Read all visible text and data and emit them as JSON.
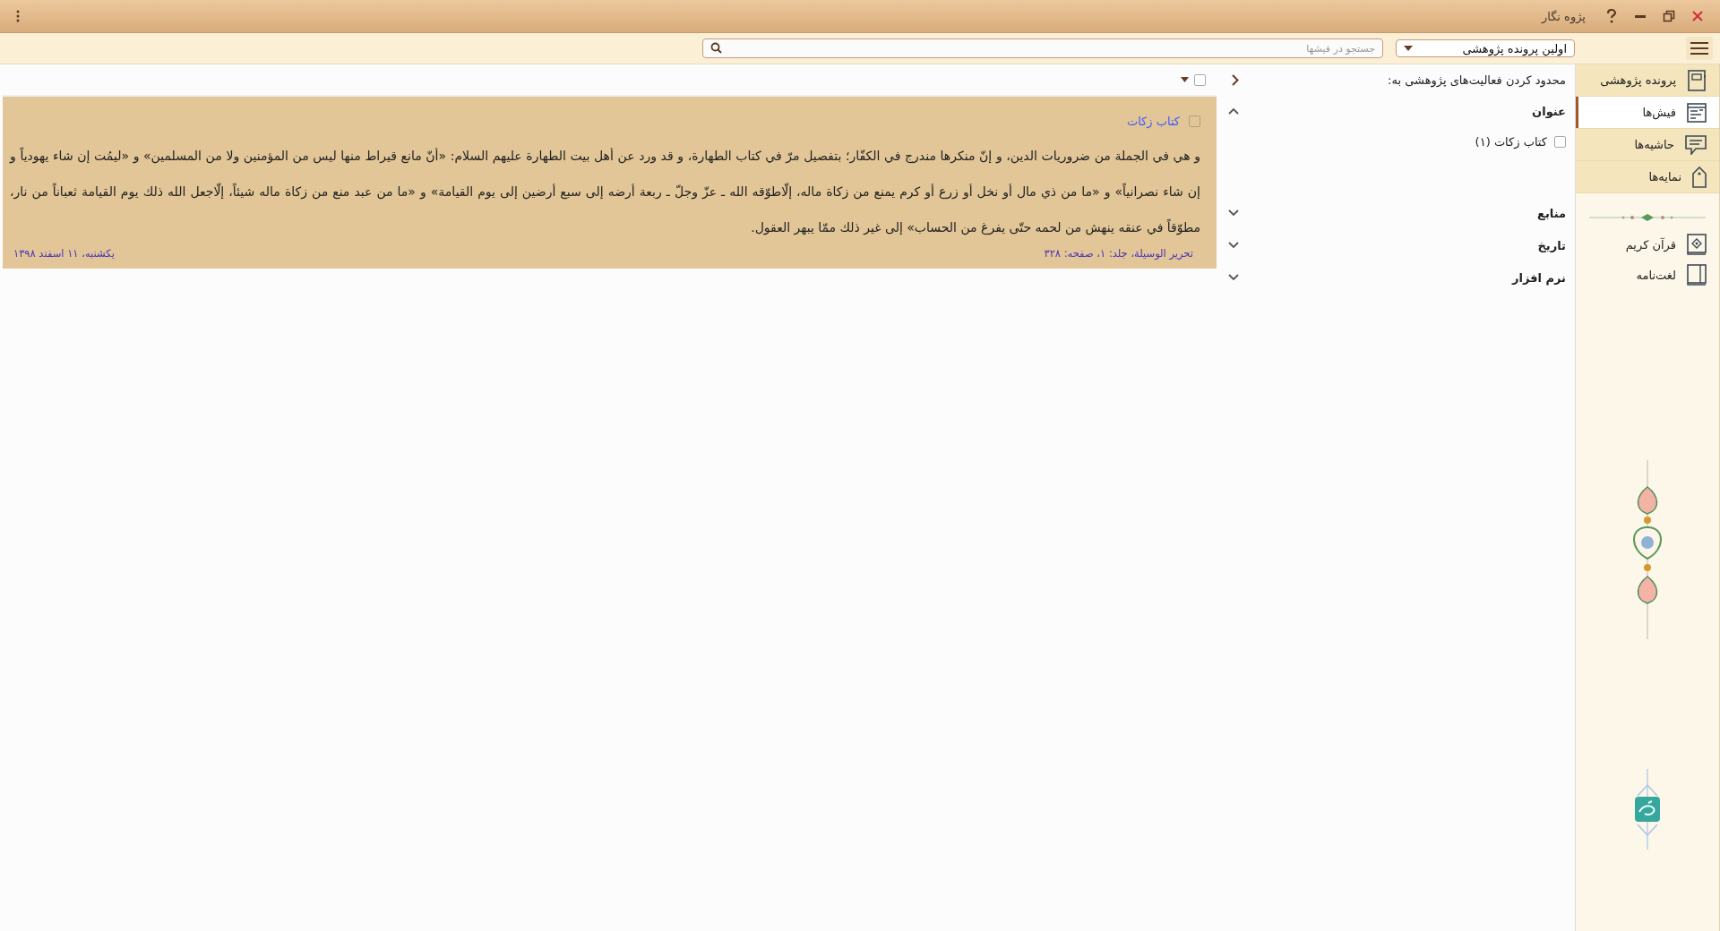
{
  "window": {
    "title": "پژوه نگار"
  },
  "toolbar": {
    "project": "اولین پرونده پژوهشی",
    "search": {
      "placeholder": "جستجو در فیشها"
    }
  },
  "nav": {
    "items": [
      {
        "label": "پرونده پژوهشی",
        "selected": false,
        "kind": "section"
      },
      {
        "label": "فیش‌ها",
        "selected": true,
        "kind": "section"
      },
      {
        "label": "حاشیه‌ها",
        "selected": false,
        "kind": "section"
      },
      {
        "label": "نمایه‌ها",
        "selected": false,
        "kind": "section"
      },
      {
        "label": "قرآن کریم",
        "selected": false,
        "kind": "book"
      },
      {
        "label": "لغت‌نامه",
        "selected": false,
        "kind": "book"
      }
    ]
  },
  "filter": {
    "heading": "محدود کردن فعالیت‌های پژوهشی به:",
    "sections": [
      {
        "title": "عنوان",
        "expanded": true,
        "items": [
          {
            "label": "کتاب زکات (۱)",
            "checked": false
          }
        ]
      },
      {
        "title": "منابع",
        "expanded": false
      },
      {
        "title": "تاریخ",
        "expanded": false
      },
      {
        "title": "نرم افزار",
        "expanded": false
      }
    ]
  },
  "notes": {
    "select_all": {
      "checked": false
    },
    "cards": [
      {
        "title": "کتاب زکات",
        "checked": false,
        "body": "و هي في الجملة من ضروريات الدين، و إنّ منكرها مندرج في الكفّار؛ بتفصيل مرّ في كتاب الطهارة، و قد ورد عن أهل بيت الطهارة عليهم السلام: «أنّ مانع قيراط منها ليس من المؤمنين ولا من المسلمين» و «ليمُت إن شاء يهودياً و إن شاء نصرانياً» و «ما من ذي مال أو نخل أو زرع أو كرم يمنع من زكاة ماله، إلّاطوّقه الله ـ عزّ وجلّ ـ ربعة أرضه إلى سبع أرضين إلى يوم القيامة» و «ما من عبد منع من زكاة ماله شيئاً، إلّاجعل الله ذلك يوم القيامة ثعباناً من نار، مطوّقاً في عنقه ينهش من لحمه حتّى يفرغ من الحساب» إلى غير ذلك ممّا يبهر العقول.",
        "source": "تحریر الوسیلة، جلد: ۱، صفحه: ۳۲۸",
        "date": "یکشنبه، ۱۱ اسفند ۱۳۹۸"
      }
    ]
  }
}
